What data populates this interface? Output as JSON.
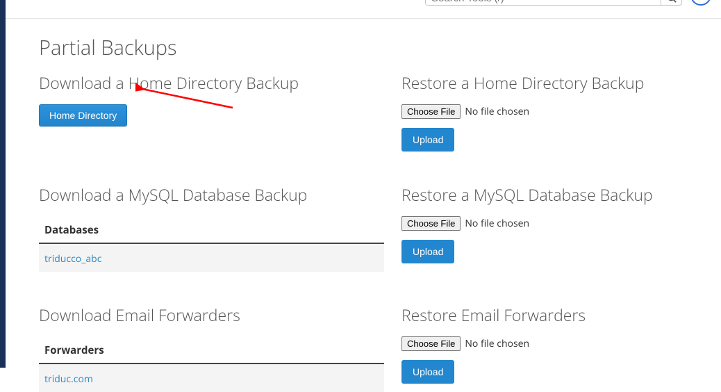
{
  "search": {
    "placeholder": "Search Tools (/)"
  },
  "page_title": "Partial Backups",
  "sections": {
    "download_home": {
      "title": "Download a Home Directory Backup",
      "button": "Home Directory"
    },
    "restore_home": {
      "title": "Restore a Home Directory Backup",
      "choose": "Choose File",
      "status": "No file chosen",
      "upload": "Upload"
    },
    "download_db": {
      "title": "Download a MySQL Database Backup",
      "table_header": "Databases",
      "rows": [
        "triducco_abc"
      ]
    },
    "restore_db": {
      "title": "Restore a MySQL Database Backup",
      "choose": "Choose File",
      "status": "No file chosen",
      "upload": "Upload"
    },
    "download_fwd": {
      "title": "Download Email Forwarders",
      "table_header": "Forwarders",
      "rows": [
        "triduc.com"
      ]
    },
    "restore_fwd": {
      "title": "Restore Email Forwarders",
      "choose": "Choose File",
      "status": "No file chosen",
      "upload": "Upload"
    }
  }
}
